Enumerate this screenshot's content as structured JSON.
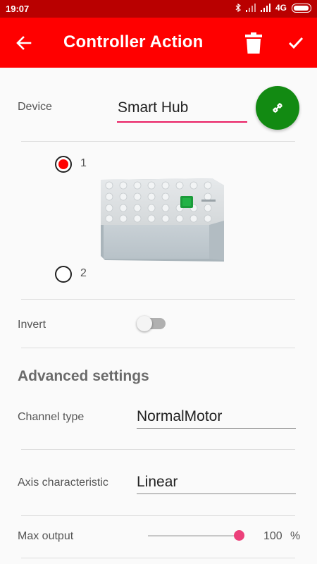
{
  "status_bar": {
    "time": "19:07",
    "network": "4G"
  },
  "app_bar": {
    "title": "Controller Action",
    "back_icon": "arrow-left-icon",
    "delete_icon": "trash-icon",
    "done_icon": "check-icon"
  },
  "device": {
    "label": "Device",
    "value": "Smart Hub",
    "link_icon": "link-icon"
  },
  "port": {
    "options": [
      {
        "label": "1",
        "checked": true
      },
      {
        "label": "2",
        "checked": false
      }
    ]
  },
  "invert": {
    "label": "Invert",
    "on": false
  },
  "advanced": {
    "title": "Advanced settings",
    "channel_type": {
      "label": "Channel type",
      "value": "NormalMotor"
    },
    "axis_characteristic": {
      "label": "Axis characteristic",
      "value": "Linear"
    },
    "max_output": {
      "label": "Max output",
      "value": "100",
      "unit": "%",
      "fraction": 1.0
    }
  },
  "colors": {
    "primary": "#ff0000",
    "primary_dark": "#b90000",
    "accent": "#e91e63",
    "link_button": "#128a12"
  }
}
